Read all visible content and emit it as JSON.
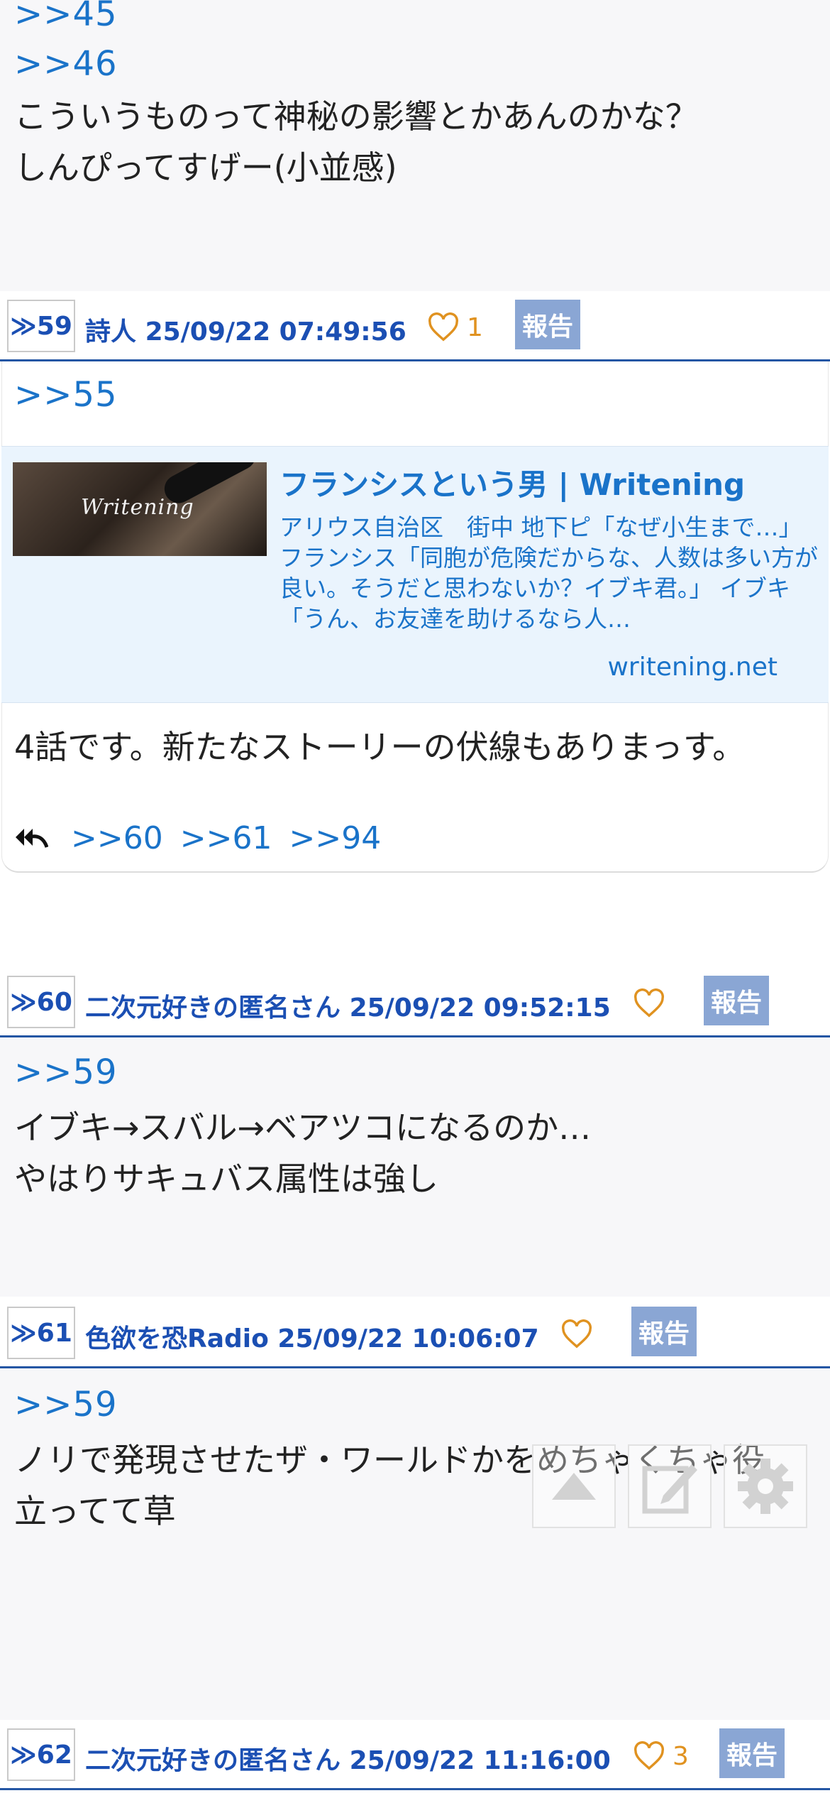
{
  "post_58": {
    "reply_refs": [
      ">>45",
      ">>46"
    ],
    "lines": [
      "こういうものって神秘の影響とかあんのかな？",
      "しんぴってすげー(小並感)"
    ]
  },
  "post_59": {
    "number": "≫59",
    "author": "詩人",
    "timestamp": "25/09/22 07:49:56",
    "likes": "1",
    "report_label": "報告",
    "reply_ref": ">>55",
    "link_card": {
      "title": "フランシスという男 | Writening",
      "description": "アリウス自治区　街中 地下ピ「なぜ小生まで…」 フランシス「同胞が危険だからな、人数は多い方が良い。そうだと思わないか？イブキ君。」 イブキ「うん、お友達を助けるなら人…",
      "domain": "writening.net",
      "image_brand": "Writening"
    },
    "text": "4話です。新たなストーリーの伏線もありまっす。",
    "replies": [
      ">>60",
      ">>61",
      ">>94"
    ]
  },
  "post_60": {
    "number": "≫60",
    "author": "二次元好きの匿名さん",
    "timestamp": "25/09/22 09:52:15",
    "likes": "",
    "report_label": "報告",
    "reply_ref": ">>59",
    "lines": [
      "イブキ→スバル→ベアツコになるのか…",
      "やはりサキュバス属性は強し"
    ]
  },
  "post_61": {
    "number": "≫61",
    "author": "色欲を恐Radio",
    "timestamp": "25/09/22 10:06:07",
    "likes": "",
    "report_label": "報告",
    "reply_ref": ">>59",
    "lines": [
      "ノリで発現させたザ・ワールドかをめちゃくちゃ役",
      "立ってて草"
    ]
  },
  "post_62": {
    "number": "≫62",
    "author": "二次元好きの匿名さん",
    "timestamp": "25/09/22 11:16:00",
    "likes": "3",
    "report_label": "報告"
  },
  "floating_buttons": [
    {
      "icon": "scroll-top-icon"
    },
    {
      "icon": "compose-icon"
    },
    {
      "icon": "gear-icon"
    }
  ],
  "colors": {
    "accent": "#1b4fb3",
    "link": "#1a73c9",
    "report_bg": "#8aa6d4",
    "like": "#e09220",
    "divider": "#2456a4"
  }
}
